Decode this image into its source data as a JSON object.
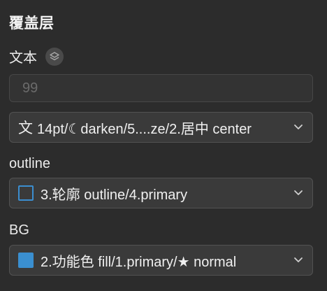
{
  "panel": {
    "section_title": "覆盖层",
    "text_row": {
      "label": "文本",
      "icon": "layers-icon",
      "input_placeholder": "99",
      "input_value": ""
    },
    "text_style_select": {
      "glyph": "文",
      "value": "14pt/☾darken/5....ze/2.居中 center"
    },
    "outline_row": {
      "label": "outline",
      "select_value": "3.轮廓 outline/4.primary",
      "swatch_color": "#3b8ed0"
    },
    "bg_row": {
      "label": "BG",
      "select_value": "2.功能色 fill/1.primary/★ normal",
      "swatch_color": "#3a8fd0"
    }
  }
}
